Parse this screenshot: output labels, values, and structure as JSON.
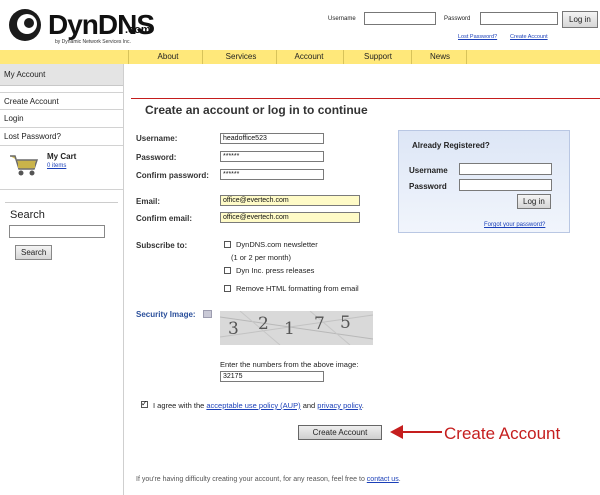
{
  "header": {
    "logo_text": "DynDNS",
    "logo_suffix": ".com",
    "logo_tagline": "by Dynamic Network Services Inc.",
    "username_label": "Username",
    "password_label": "Password",
    "login_button": "Log in",
    "lost_password_link": "Lost Password?",
    "create_account_link": "Create Account"
  },
  "nav": {
    "items": [
      "About",
      "Services",
      "Account",
      "Support",
      "News"
    ]
  },
  "sidebar": {
    "heading": "My Account",
    "items": [
      "Create Account",
      "Login",
      "Lost Password?"
    ],
    "cart_title": "My Cart",
    "cart_items": "0 items",
    "search_label": "Search",
    "search_button": "Search"
  },
  "form": {
    "title": "Create an account or log in to continue",
    "username_label": "Username:",
    "username_value": "headoffice523",
    "password_label": "Password:",
    "password_value": "******",
    "confirm_password_label": "Confirm password:",
    "confirm_password_value": "******",
    "email_label": "Email:",
    "email_value": "office@evertech.com",
    "confirm_email_label": "Confirm email:",
    "confirm_email_value": "office@evertech.com",
    "subscribe_label": "Subscribe to:",
    "subscribe_options": [
      {
        "text": "DynDNS.com newsletter",
        "checked": false
      },
      {
        "text": "Dyn Inc. press releases",
        "checked": false
      },
      {
        "text": "Remove HTML formatting from email",
        "checked": false
      }
    ],
    "newsletter_note": "(1 or 2 per month)",
    "security_label": "Security Image:",
    "captcha_chars": [
      "3",
      "2",
      "1",
      "7",
      "5"
    ],
    "captcha_help": "Enter the numbers from the above image:",
    "captcha_value": "32175",
    "agree_checked": true,
    "agree_prefix": "I agree with the",
    "agree_aup": "acceptable use policy (AUP)",
    "agree_and": "and",
    "agree_privacy": "privacy policy",
    "agree_period": ".",
    "create_button": "Create Account",
    "annotation": "Create Account"
  },
  "login_box": {
    "title": "Already Registered?",
    "username_label": "Username",
    "password_label": "Password",
    "button": "Log in",
    "forgot_link": "Forgot your password?"
  },
  "footer": {
    "message": "If you're having difficulty creating your account, for any reason, feel free to",
    "link": "contact us",
    "period": "."
  },
  "colors": {
    "nav_bg": "#ffe87a",
    "accent_red": "#c41d1d",
    "link_blue": "#1a3fb8",
    "field_highlight": "#fffbc7"
  }
}
